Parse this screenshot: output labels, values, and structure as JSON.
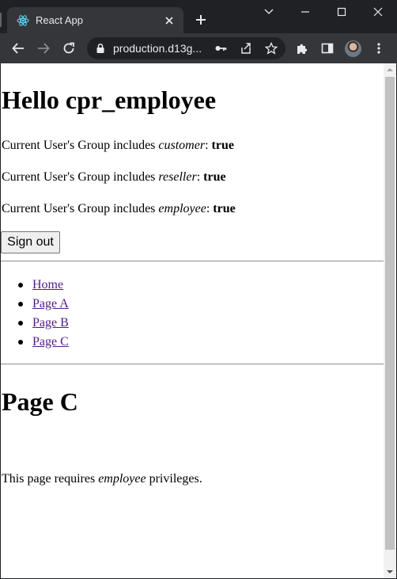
{
  "browser": {
    "tab_title": "React App",
    "url": "production.d13g...",
    "icons": {
      "favicon": "react-logo-icon",
      "tab_close": "close-icon",
      "new_tab": "plus-icon",
      "dropdown": "chevron-down-icon",
      "minimize": "minimize-icon",
      "maximize": "maximize-icon",
      "close_window": "close-icon",
      "back": "arrow-left-icon",
      "forward": "arrow-right-icon",
      "reload": "reload-icon",
      "lock": "lock-icon",
      "key": "key-icon",
      "share": "share-icon",
      "bookmark": "star-icon",
      "extensions": "puzzle-icon",
      "side_panel": "side-panel-icon",
      "profile": "avatar",
      "menu": "kebab-menu-icon"
    }
  },
  "page": {
    "greeting": "Hello cpr_employee",
    "groups": [
      {
        "prefix": "Current User's Group includes ",
        "group": "customer",
        "sep": ": ",
        "value": "true"
      },
      {
        "prefix": "Current User's Group includes ",
        "group": "reseller",
        "sep": ": ",
        "value": "true"
      },
      {
        "prefix": "Current User's Group includes ",
        "group": "employee",
        "sep": ": ",
        "value": "true"
      }
    ],
    "sign_out_label": "Sign out",
    "nav": [
      {
        "label": "Home"
      },
      {
        "label": "Page A"
      },
      {
        "label": "Page B"
      },
      {
        "label": "Page C"
      }
    ],
    "section_title": "Page C",
    "notice_prefix": "This page requires ",
    "notice_role": "employee",
    "notice_suffix": " privileges."
  },
  "colors": {
    "chrome_dark": "#202124",
    "chrome_toolbar": "#35363a",
    "link_visited": "#551a8b"
  }
}
